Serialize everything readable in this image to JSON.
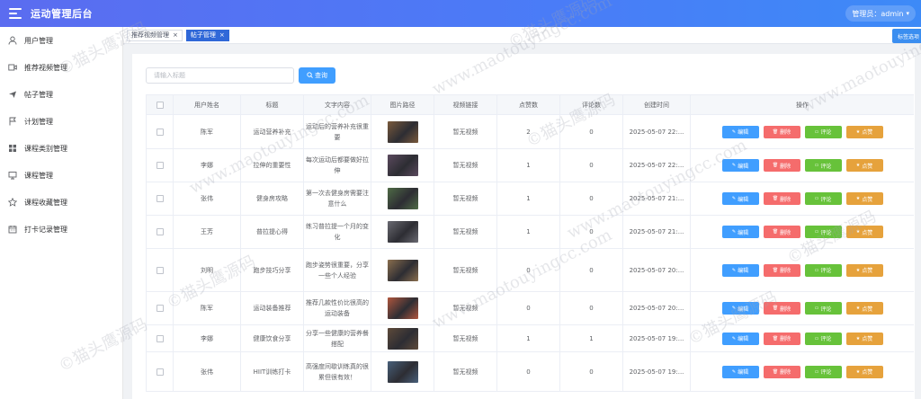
{
  "header": {
    "title": "运动管理后台",
    "user_label": "管理员：admin"
  },
  "sidebar": {
    "items": [
      {
        "label": "用户管理",
        "icon": "user-icon"
      },
      {
        "label": "推荐视频管理",
        "icon": "video-icon"
      },
      {
        "label": "帖子管理",
        "icon": "send-icon"
      },
      {
        "label": "计划管理",
        "icon": "flag-icon"
      },
      {
        "label": "课程类别管理",
        "icon": "grid-icon"
      },
      {
        "label": "课程管理",
        "icon": "monitor-icon"
      },
      {
        "label": "课程收藏管理",
        "icon": "star-icon"
      },
      {
        "label": "打卡记录管理",
        "icon": "calendar-icon"
      }
    ]
  },
  "tabs": [
    {
      "label": "推荐视频管理",
      "active": false
    },
    {
      "label": "帖子管理",
      "active": true
    }
  ],
  "tag_button": "标签选项",
  "search": {
    "placeholder": "请输入标题",
    "button": "查询"
  },
  "table": {
    "headers": [
      "用户姓名",
      "标题",
      "文字内容",
      "图片路径",
      "视频链接",
      "点赞数",
      "评论数",
      "创建时间",
      "操作"
    ],
    "actions": [
      "编辑",
      "删除",
      "评论",
      "点赞"
    ],
    "rows": [
      {
        "user": "陈军",
        "title": "运动营养补充",
        "content": "运动后的营养补充很重要",
        "video": "暂无视频",
        "likes": "2",
        "comments": "0",
        "time": "2025-05-07 22:...",
        "img": "#7a5a3c"
      },
      {
        "user": "李娜",
        "title": "拉伸的重要性",
        "content": "每次运动后都要做好拉伸",
        "video": "暂无视频",
        "likes": "1",
        "comments": "0",
        "time": "2025-05-07 22:...",
        "img": "#5b4a5e"
      },
      {
        "user": "张伟",
        "title": "健身房攻略",
        "content": "第一次去健身房需要注意什么",
        "video": "暂无视频",
        "likes": "1",
        "comments": "0",
        "time": "2025-05-07 21:...",
        "img": "#4f6b46"
      },
      {
        "user": "王芳",
        "title": "普拉提心得",
        "content": "练习普拉提一个月的变化",
        "video": "暂无视频",
        "likes": "1",
        "comments": "0",
        "time": "2025-05-07 21:...",
        "img": "#6a6a72"
      },
      {
        "user": "刘明",
        "title": "跑步技巧分享",
        "content": "跑步姿势很重要，分享一些个人经验",
        "video": "暂无视频",
        "likes": "0",
        "comments": "0",
        "time": "2025-05-07 20:...",
        "img": "#8a6e4e"
      },
      {
        "user": "陈军",
        "title": "运动装备推荐",
        "content": "推荐几款性价比很高的运动装备",
        "video": "暂无视频",
        "likes": "0",
        "comments": "0",
        "time": "2025-05-07 20:...",
        "img": "#b0563e"
      },
      {
        "user": "李娜",
        "title": "健康饮食分享",
        "content": "分享一些健康的营养餐搭配",
        "video": "暂无视频",
        "likes": "1",
        "comments": "1",
        "time": "2025-05-07 19:...",
        "img": "#5e4a3a"
      },
      {
        "user": "张伟",
        "title": "HIIT训练打卡",
        "content": "高强度间歇训练真的很累但很有效！",
        "video": "暂无视频",
        "likes": "0",
        "comments": "0",
        "time": "2025-05-07 19:...",
        "img": "#48607a"
      }
    ]
  },
  "watermark": [
    "©猫头鹰源码",
    "www.maotouyingcc.com"
  ],
  "colors": {
    "header": "#4a7cf7",
    "primary": "#409eff",
    "danger": "#f56c6c",
    "success": "#67c23a",
    "warning": "#e6a23c",
    "active_tab": "#3068d8"
  }
}
